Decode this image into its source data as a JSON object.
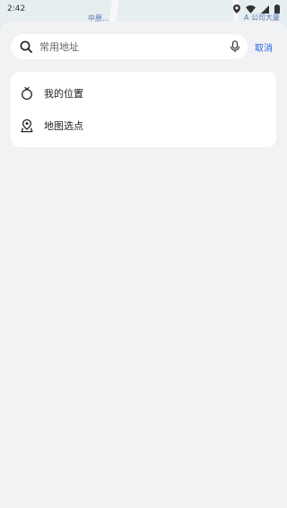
{
  "status_bar": {
    "time": "2:42",
    "map_label_left": "中原...",
    "map_label_right": "A 公司大厦"
  },
  "search": {
    "placeholder": "常用地址",
    "value": "",
    "cancel_label": "取消"
  },
  "menu": {
    "items": [
      {
        "label": "我的位置",
        "icon": "my-location-icon"
      },
      {
        "label": "地图选点",
        "icon": "map-pick-pin-icon"
      }
    ]
  },
  "colors": {
    "accent": "#2a66e6",
    "sheet_bg": "#f1f2f4",
    "card_bg": "#ffffff"
  }
}
